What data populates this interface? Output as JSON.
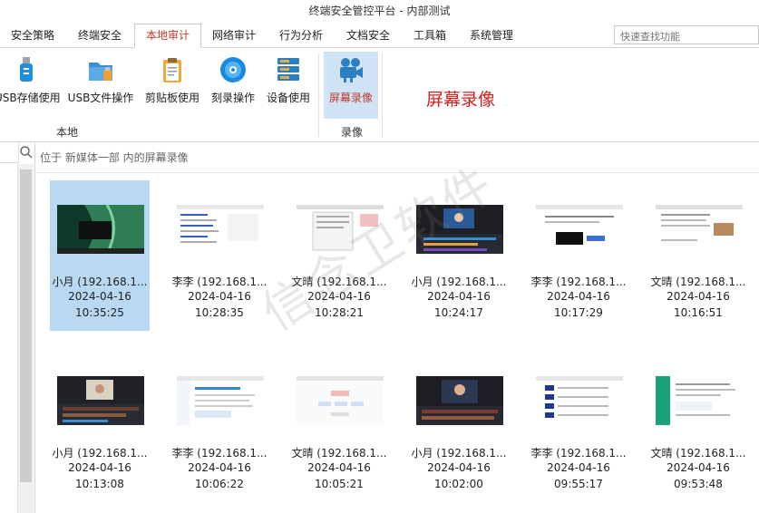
{
  "window": {
    "title": "终端安全管控平台 - 内部测试"
  },
  "tabs": [
    {
      "label": "安全策略"
    },
    {
      "label": "终端安全"
    },
    {
      "label": "本地审计"
    },
    {
      "label": "网络审计"
    },
    {
      "label": "行为分析"
    },
    {
      "label": "文档安全"
    },
    {
      "label": "工具箱"
    },
    {
      "label": "系统管理"
    }
  ],
  "active_tab": "本地审计",
  "search": {
    "placeholder": "快速查找功能"
  },
  "ribbon": {
    "buttons": [
      {
        "label": "USB存储使用",
        "icon": "usb-storage-icon"
      },
      {
        "label": "USB文件操作",
        "icon": "usb-file-icon"
      },
      {
        "label": "剪贴板使用",
        "icon": "clipboard-icon"
      },
      {
        "label": "刻录操作",
        "icon": "disc-burn-icon"
      },
      {
        "label": "设备使用",
        "icon": "device-icon"
      },
      {
        "label": "屏幕录像",
        "icon": "video-camera-icon"
      }
    ],
    "groups": [
      {
        "label": "本地"
      },
      {
        "label": "录像"
      }
    ],
    "heading": "屏幕录像"
  },
  "breadcrumb": "位于 新媒体一部 内的屏幕录像",
  "watermark": "信念卫软件",
  "recordings": [
    {
      "name": "小月 (192.168.1...",
      "date": "2024-04-16",
      "time": "10:35:25",
      "thumb": "desktop"
    },
    {
      "name": "李李 (192.168.1...",
      "date": "2024-04-16",
      "time": "10:28:35",
      "thumb": "web"
    },
    {
      "name": "文晴 (192.168.1...",
      "date": "2024-04-16",
      "time": "10:28:21",
      "thumb": "sheet"
    },
    {
      "name": "小月 (192.168.1...",
      "date": "2024-04-16",
      "time": "10:24:17",
      "thumb": "video"
    },
    {
      "name": "李李 (192.168.1...",
      "date": "2024-04-16",
      "time": "10:17:29",
      "thumb": "web2"
    },
    {
      "name": "文晴 (192.168.1...",
      "date": "2024-04-16",
      "time": "10:16:51",
      "thumb": "doc"
    },
    {
      "name": "小月 (192.168.1...",
      "date": "2024-04-16",
      "time": "10:13:08",
      "thumb": "video2"
    },
    {
      "name": "李李 (192.168.1...",
      "date": "2024-04-16",
      "time": "10:06:22",
      "thumb": "web3"
    },
    {
      "name": "文晴 (192.168.1...",
      "date": "2024-04-16",
      "time": "10:05:21",
      "thumb": "mind"
    },
    {
      "name": "小月 (192.168.1...",
      "date": "2024-04-16",
      "time": "10:02:00",
      "thumb": "video3"
    },
    {
      "name": "李李 (192.168.1...",
      "date": "2024-04-16",
      "time": "09:55:17",
      "thumb": "list"
    },
    {
      "name": "文晴 (192.168.1...",
      "date": "2024-04-16",
      "time": "09:53:48",
      "thumb": "green"
    }
  ],
  "colors": {
    "accent": "#c0392b",
    "selection": "#b9d8f2",
    "heading_red": "#d02020"
  }
}
